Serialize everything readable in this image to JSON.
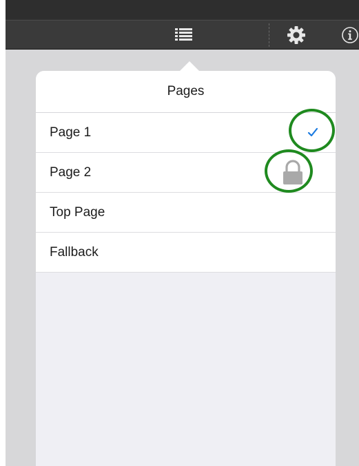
{
  "toolbar": {
    "icons": [
      "list-icon",
      "gear-icon",
      "info-icon"
    ]
  },
  "popover": {
    "title": "Pages",
    "rows": [
      {
        "label": "Page 1",
        "status": "selected",
        "status_icon": "checkmark-icon"
      },
      {
        "label": "Page 2",
        "status": "locked",
        "status_icon": "lock-icon"
      },
      {
        "label": "Top Page",
        "status": "none"
      },
      {
        "label": "Fallback",
        "status": "none"
      }
    ]
  },
  "colors": {
    "toolbar": "#3a3a3a",
    "highlight_ring": "#1f8a1f",
    "checkmark": "#1a7ae0",
    "lock": "#a9a9a9",
    "popover_background": "#efeff4"
  }
}
